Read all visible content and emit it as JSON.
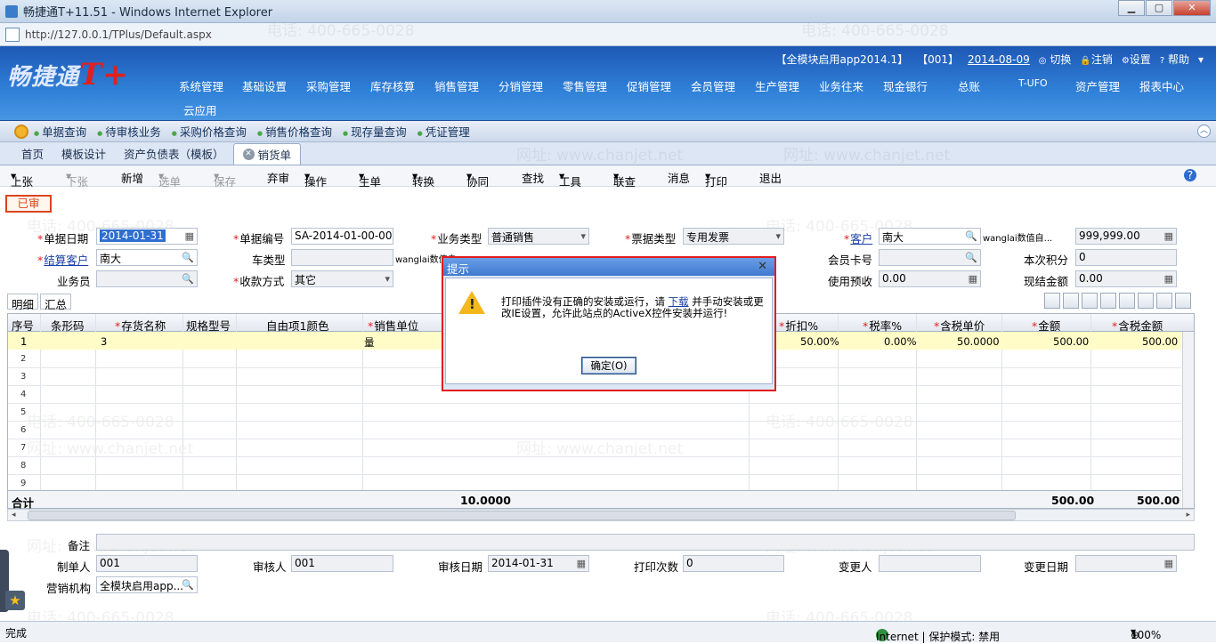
{
  "window": {
    "title": "畅捷通T+11.51 - Windows Internet Explorer",
    "url": "http://127.0.0.1/TPlus/Default.aspx"
  },
  "header": {
    "logo_text": "畅捷通",
    "logo_mark": "T+",
    "account": "【全模块启用app2014.1】",
    "user": "【001】",
    "date": "2014-08-09",
    "switch": "切换",
    "logout": "注销",
    "settings": "设置",
    "help": "帮助"
  },
  "nav": [
    "系统管理",
    "基础设置",
    "采购管理",
    "库存核算",
    "销售管理",
    "分销管理",
    "零售管理",
    "促销管理",
    "会员管理",
    "生产管理",
    "业务往来",
    "现金银行",
    "总账",
    "T-UFO",
    "资产管理",
    "报表中心",
    "云应用"
  ],
  "quick": [
    "单据查询",
    "待审核业务",
    "采购价格查询",
    "销售价格查询",
    "现存量查询",
    "凭证管理"
  ],
  "tabs": [
    "首页",
    "模板设计",
    "资产负债表（模板）",
    "销货单"
  ],
  "toolbar": [
    "上张",
    "下张",
    "新增",
    "选单",
    "保存",
    "弃审",
    "操作",
    "生单",
    "转换",
    "协同",
    "查找",
    "工具",
    "联查",
    "消息",
    "打印",
    "退出"
  ],
  "status_stamp": "已审",
  "form": {
    "doc_date_label": "单据日期",
    "doc_date": "2014-01-31",
    "doc_no_label": "单据编号",
    "doc_no": "SA-2014-01-00-00...",
    "biz_type_label": "业务类型",
    "biz_type": "普通销售",
    "invoice_type_label": "票据类型",
    "invoice_type": "专用发票",
    "customer_label": "客户",
    "customer": "南大",
    "balance_label": "wanglai数值自...",
    "balance": "999,999.00",
    "settle_customer_label": "结算客户",
    "settle_customer": "南大",
    "vehicle_label": "车类型",
    "vehicle_extra": "wanglai数值自",
    "member_label": "会员卡号",
    "points_label": "本次积分",
    "points": "0",
    "salesman_label": "业务员",
    "payment_label": "收款方式",
    "payment": "其它",
    "prepay_label": "使用预收",
    "prepay": "0.00",
    "cash_label": "现结金额",
    "cash": "0.00"
  },
  "subtabs": [
    "明细",
    "汇总"
  ],
  "grid": {
    "headers": [
      "序号",
      "条形码",
      "存货名称",
      "规格型号",
      "自由项1颜色",
      "销售单位",
      "折扣%",
      "税率%",
      "含税单价",
      "金额",
      "含税金额"
    ],
    "row1": {
      "no": "1",
      "name": "3",
      "unit": "量",
      "discount": "50.00%",
      "tax": "0.00%",
      "price": "50.0000",
      "amount": "500.00",
      "tax_amount": "500.00"
    },
    "row_numbers": [
      "2",
      "3",
      "4",
      "5",
      "6",
      "7",
      "8",
      "9"
    ],
    "total_label": "合计",
    "total_qty": "10.0000",
    "total_amount": "500.00",
    "total_tax_amount": "500.00"
  },
  "footer": {
    "remark_label": "备注",
    "maker_label": "制单人",
    "maker": "001",
    "auditor_label": "审核人",
    "auditor": "001",
    "audit_date_label": "审核日期",
    "audit_date": "2014-01-31",
    "print_count_label": "打印次数",
    "print_count": "0",
    "changer_label": "变更人",
    "change_date_label": "变更日期",
    "org_label": "营销机构",
    "org": "全模块启用app..."
  },
  "dialog": {
    "title": "提示",
    "msg_before_link": "打印插件没有正确的安装或运行，请 ",
    "link": "下载",
    "msg_after_link": " 并手动安装或更改IE设置，允许此站点的ActiveX控件安装并运行!",
    "ok": "确定(O)"
  },
  "statusbar": {
    "left": "完成",
    "zone": "Internet | 保护模式: 禁用",
    "zoom": "100%"
  },
  "watermarks": [
    "电话: 400-665-0028",
    "网址: www.chanjet.net"
  ]
}
